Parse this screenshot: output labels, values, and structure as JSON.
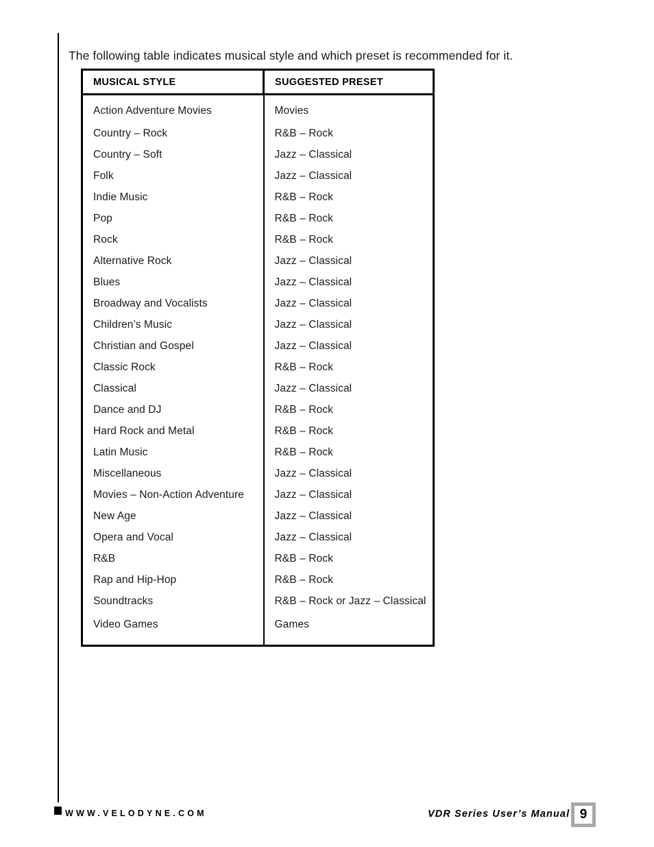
{
  "page": {
    "intro_text": "The following table indicates musical style and which preset is recommended for it."
  },
  "table": {
    "headers": [
      "MUSICAL STYLE",
      "SUGGESTED PRESET"
    ],
    "rows": [
      [
        "Action Adventure Movies",
        "Movies"
      ],
      [
        "Country – Rock",
        "R&B – Rock"
      ],
      [
        "Country – Soft",
        "Jazz – Classical"
      ],
      [
        "Folk",
        "Jazz – Classical"
      ],
      [
        "Indie Music",
        "R&B – Rock"
      ],
      [
        "Pop",
        "R&B – Rock"
      ],
      [
        "Rock",
        "R&B – Rock"
      ],
      [
        "Alternative Rock",
        "Jazz – Classical"
      ],
      [
        "Blues",
        "Jazz – Classical"
      ],
      [
        "Broadway and Vocalists",
        "Jazz – Classical"
      ],
      [
        "Children’s Music",
        "Jazz – Classical"
      ],
      [
        "Christian and Gospel",
        "Jazz – Classical"
      ],
      [
        "Classic Rock",
        "R&B – Rock"
      ],
      [
        "Classical",
        "Jazz – Classical"
      ],
      [
        "Dance and DJ",
        "R&B – Rock"
      ],
      [
        "Hard Rock and Metal",
        "R&B – Rock"
      ],
      [
        "Latin Music",
        "R&B – Rock"
      ],
      [
        "Miscellaneous",
        "Jazz – Classical"
      ],
      [
        "Movies – Non-Action Adventure",
        "Jazz – Classical"
      ],
      [
        "New Age",
        "Jazz – Classical"
      ],
      [
        "Opera and Vocal",
        "Jazz – Classical"
      ],
      [
        "R&B",
        "R&B – Rock"
      ],
      [
        "Rap and Hip-Hop",
        "R&B – Rock"
      ],
      [
        "Soundtracks",
        "R&B – Rock or Jazz – Classical"
      ],
      [
        "Video Games",
        "Games"
      ]
    ]
  },
  "footer": {
    "website": "WWW.VELODYNE.COM",
    "manual_title": "VDR Series User’s Manual",
    "page_number": "9"
  },
  "colors": {
    "text": "#1a1a1a",
    "rule": "#000000",
    "page_box_border": "#a8a8a8"
  }
}
